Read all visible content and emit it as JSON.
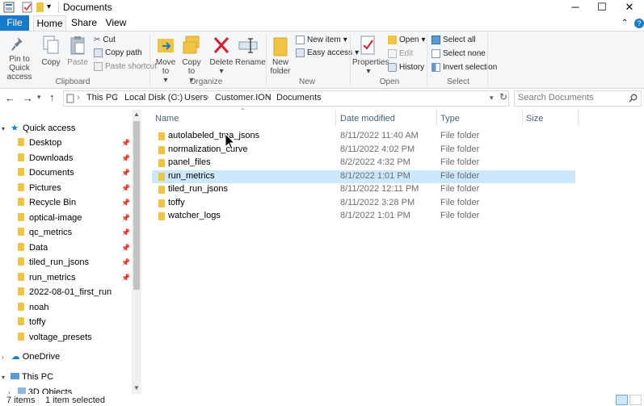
{
  "window": {
    "title": "Documents",
    "controls": {
      "minimize": "─",
      "maximize": "☐",
      "close": "✕"
    }
  },
  "tabs": {
    "file": "File",
    "home": "Home",
    "share": "Share",
    "view": "View",
    "help": "?"
  },
  "ribbon": {
    "clipboard": {
      "group_label": "Clipboard",
      "pin": "Pin to Quick access",
      "copy": "Copy",
      "paste": "Paste",
      "cut": "Cut",
      "copy_path": "Copy path",
      "paste_shortcut": "Paste shortcut"
    },
    "organize": {
      "group_label": "Organize",
      "move_to": "Move to",
      "copy_to": "Copy to",
      "delete": "Delete",
      "rename": "Rename"
    },
    "new": {
      "group_label": "New",
      "new_folder": "New folder",
      "new_item": "New item",
      "easy_access": "Easy access"
    },
    "open": {
      "group_label": "Open",
      "properties": "Properties",
      "open": "Open",
      "edit": "Edit",
      "history": "History"
    },
    "select": {
      "group_label": "Select",
      "select_all": "Select all",
      "select_none": "Select none",
      "invert": "Invert selection"
    }
  },
  "address": {
    "crumbs": [
      "This PC",
      "Local Disk (C:)",
      "Users",
      "Customer.ION",
      "Documents"
    ],
    "separator": "›",
    "search_placeholder": "Search Documents"
  },
  "sidebar": {
    "quick_access": "Quick access",
    "items": [
      {
        "label": "Desktop",
        "pinned": true
      },
      {
        "label": "Downloads",
        "pinned": true
      },
      {
        "label": "Documents",
        "pinned": true
      },
      {
        "label": "Pictures",
        "pinned": true
      },
      {
        "label": "Recycle Bin",
        "pinned": true
      },
      {
        "label": "optical-image",
        "pinned": true
      },
      {
        "label": "qc_metrics",
        "pinned": true
      },
      {
        "label": "Data",
        "pinned": true
      },
      {
        "label": "tiled_run_jsons",
        "pinned": true
      },
      {
        "label": "run_metrics",
        "pinned": true
      },
      {
        "label": "2022-08-01_first_run",
        "pinned": false
      },
      {
        "label": "noah",
        "pinned": false
      },
      {
        "label": "toffy",
        "pinned": false
      },
      {
        "label": "voltage_presets",
        "pinned": false
      }
    ],
    "onedrive": "OneDrive",
    "this_pc": "This PC",
    "objects3d": "3D Objects"
  },
  "columns": {
    "name": "Name",
    "date": "Date modified",
    "type": "Type",
    "size": "Size"
  },
  "files": [
    {
      "name": "autolabeled_tma_jsons",
      "date": "8/11/2022 11:40 AM",
      "type": "File folder"
    },
    {
      "name": "normalization_curve",
      "date": "8/11/2022 4:02 PM",
      "type": "File folder"
    },
    {
      "name": "panel_files",
      "date": "8/2/2022 4:32 PM",
      "type": "File folder"
    },
    {
      "name": "run_metrics",
      "date": "8/1/2022 1:01 PM",
      "type": "File folder",
      "selected": true
    },
    {
      "name": "tiled_run_jsons",
      "date": "8/11/2022 12:11 PM",
      "type": "File folder"
    },
    {
      "name": "toffy",
      "date": "8/11/2022 3:28 PM",
      "type": "File folder"
    },
    {
      "name": "watcher_logs",
      "date": "8/1/2022 1:01 PM",
      "type": "File folder"
    }
  ],
  "status": {
    "count": "7 items",
    "selected": "1 item selected"
  },
  "colors": {
    "accent": "#1979ca",
    "selection": "#cce8ff",
    "folder": "#f0c443"
  }
}
